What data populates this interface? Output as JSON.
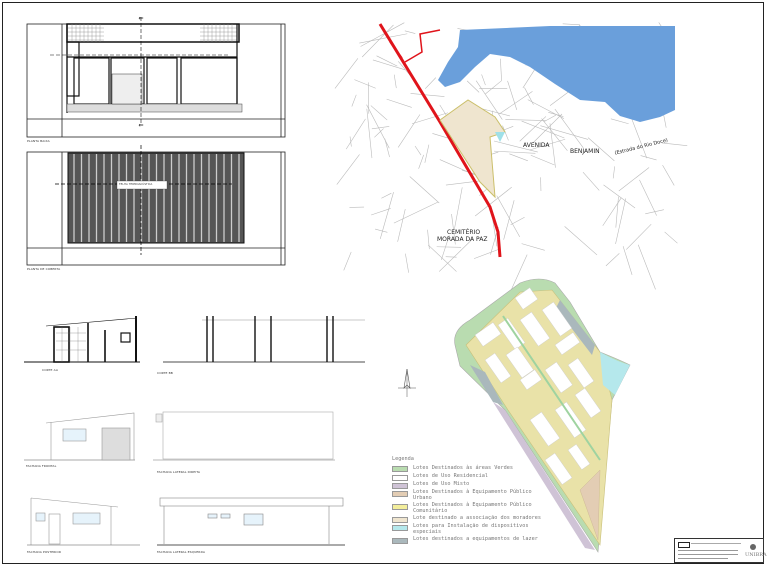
{
  "sheet": {
    "drawings": {
      "floor_plan": {
        "label": "PLANTA BAIXA"
      },
      "roof_plan": {
        "label": "PLANTA DE COBERTA",
        "note": "TELHA TERMOACÚSTICA"
      },
      "section_aa": {
        "label": "CORTE AA"
      },
      "section_bb": {
        "label": "CORTE BB"
      },
      "front_facade": {
        "label": "FACHADA FRONTAL"
      },
      "right_facade": {
        "label": "FACHADA LATERAL DIREITA"
      },
      "rear_facade": {
        "label": "FACHADA POSTERIOR"
      },
      "left_facade": {
        "label": "FACHADA LATERAL ESQUERDA"
      }
    },
    "map": {
      "labels": [
        "AVENIDA",
        "BENJAMIN",
        "(Estrada do Rio Doce)",
        "CEMITÉRIO",
        "MORADA DA PAZ"
      ],
      "colors": {
        "water": "#6a9fdb",
        "highway": "#e0141b",
        "streets": "#b8b8b8"
      }
    },
    "site_plan": {
      "legend_title": "Legenda",
      "legend": [
        {
          "label": "Lotes Destinados às áreas Verdes",
          "color": "#b9dcb0"
        },
        {
          "label": "Lotes de Uso Residencial",
          "color": "#ffffff"
        },
        {
          "label": "Lotes de Uso Misto",
          "color": "#cfc3d6"
        },
        {
          "label": "Lotes Destinados à Equipamento Público Urbano",
          "color": "#e3cdb4"
        },
        {
          "label": "Lotes Destinados à Equipamento Público Comunitário",
          "color": "#f3ee9c"
        },
        {
          "label": "Lote destinado a associação dos moradores",
          "color": "#efe5cf"
        },
        {
          "label": "Lotes para Instalação de dispositivos especiais",
          "color": "#b5e8ec"
        },
        {
          "label": "Lotes destinados a equipamentos de lazer",
          "color": "#aab8bc"
        }
      ]
    },
    "title_block": {
      "logo": "UNIBRA"
    }
  }
}
